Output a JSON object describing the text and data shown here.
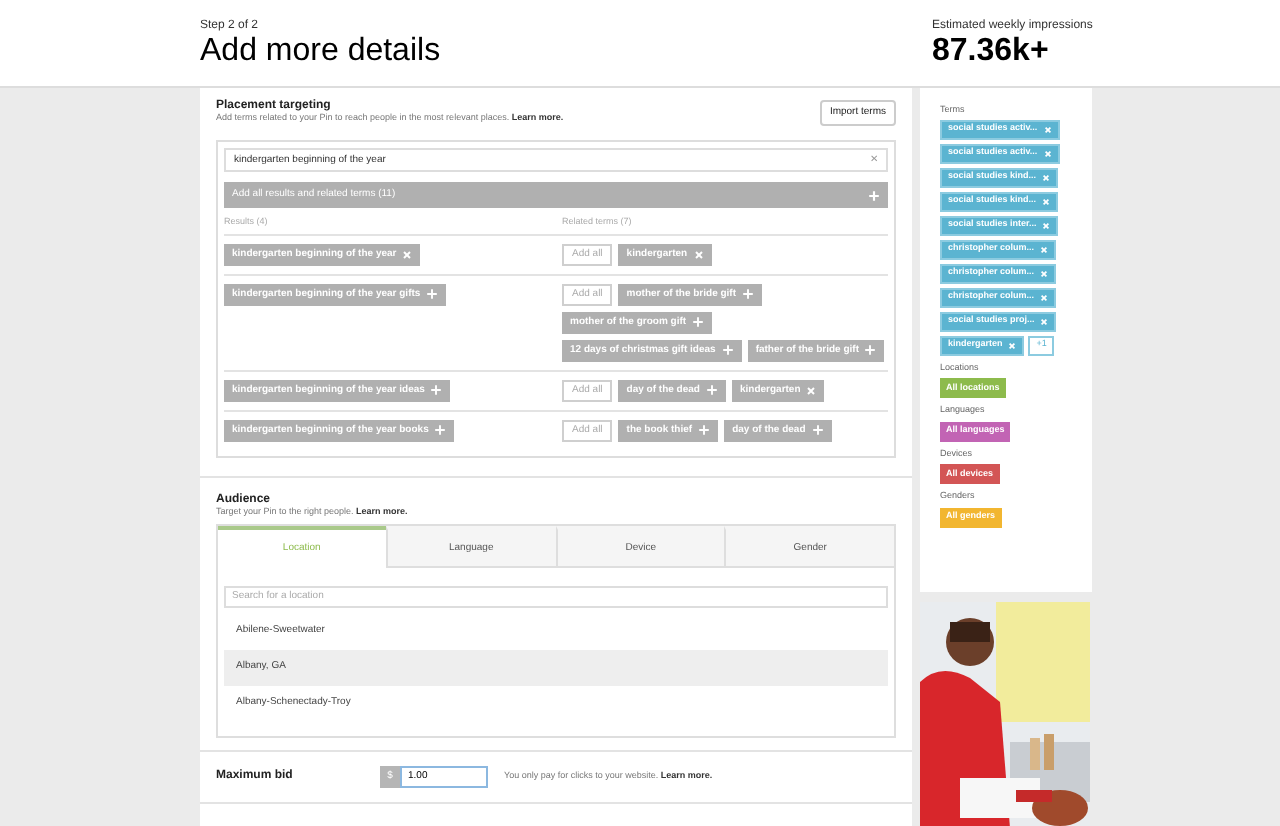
{
  "header": {
    "step": "Step 2 of 2",
    "title": "Add more details",
    "impressions_label": "Estimated weekly impressions",
    "impressions_value": "87.36k+"
  },
  "placement": {
    "title": "Placement targeting",
    "description": "Add terms related to your Pin to reach people in the most relevant places.",
    "learn_more": "Learn more.",
    "import_button": "Import terms",
    "search_value": "kindergarten beginning of the year",
    "clear_icon": "✕",
    "add_all_label": "Add all results and related terms (11)",
    "results_header": "Results (4)",
    "related_header": "Related terms (7)",
    "rows": [
      {
        "add_all_button": "Add all",
        "result": {
          "label": "kindergarten beginning of the year",
          "added": true
        },
        "related": [
          {
            "label": "kindergarten",
            "added": true
          }
        ]
      },
      {
        "add_all_button": "Add all",
        "result": {
          "label": "kindergarten beginning of the year gifts",
          "added": false
        },
        "related": [
          {
            "label": "mother of the bride gift",
            "added": false
          },
          {
            "label": "mother of the groom gift",
            "added": false
          },
          {
            "label": "12 days of christmas gift ideas",
            "added": false
          },
          {
            "label": "father of the bride gift",
            "added": false
          }
        ]
      },
      {
        "add_all_button": "Add all",
        "result": {
          "label": "kindergarten beginning of the year ideas",
          "added": false
        },
        "related": [
          {
            "label": "day of the dead",
            "added": false
          },
          {
            "label": "kindergarten",
            "added": true
          }
        ]
      },
      {
        "add_all_button": "Add all",
        "result": {
          "label": "kindergarten beginning of the year books",
          "added": false
        },
        "related": [
          {
            "label": "the book thief",
            "added": false
          },
          {
            "label": "day of the dead",
            "added": false
          }
        ]
      }
    ]
  },
  "audience": {
    "title": "Audience",
    "description": "Target your Pin to the right people.",
    "learn_more": "Learn more.",
    "tabs": [
      {
        "label": "Location",
        "selected": true
      },
      {
        "label": "Language",
        "selected": false
      },
      {
        "label": "Device",
        "selected": false
      },
      {
        "label": "Gender",
        "selected": false
      }
    ],
    "search_placeholder": "Search for a location",
    "locations": [
      {
        "name": "Abilene-Sweetwater",
        "highlighted": false
      },
      {
        "name": "Albany, GA",
        "highlighted": true
      },
      {
        "name": "Albany-Schenectady-Troy",
        "highlighted": false
      }
    ]
  },
  "bid": {
    "label": "Maximum bid",
    "currency": "$",
    "value": "1.00",
    "note": "You only pay for clicks to your website.",
    "learn_more": "Learn more."
  },
  "sidebar": {
    "terms_label": "Terms",
    "terms": [
      "social studies activ...",
      "social studies activ...",
      "social studies kind...",
      "social studies kind...",
      "social studies inter...",
      "christopher colum...",
      "christopher colum...",
      "christopher colum...",
      "social studies proj...",
      "kindergarten"
    ],
    "more": "+1",
    "groups": [
      {
        "label": "Locations",
        "value": "All locations",
        "color": "#8dbb4c"
      },
      {
        "label": "Languages",
        "value": "All languages",
        "color": "#c264b4"
      },
      {
        "label": "Devices",
        "value": "All devices",
        "color": "#d35555"
      },
      {
        "label": "Genders",
        "value": "All genders",
        "color": "#f2b630"
      }
    ]
  }
}
